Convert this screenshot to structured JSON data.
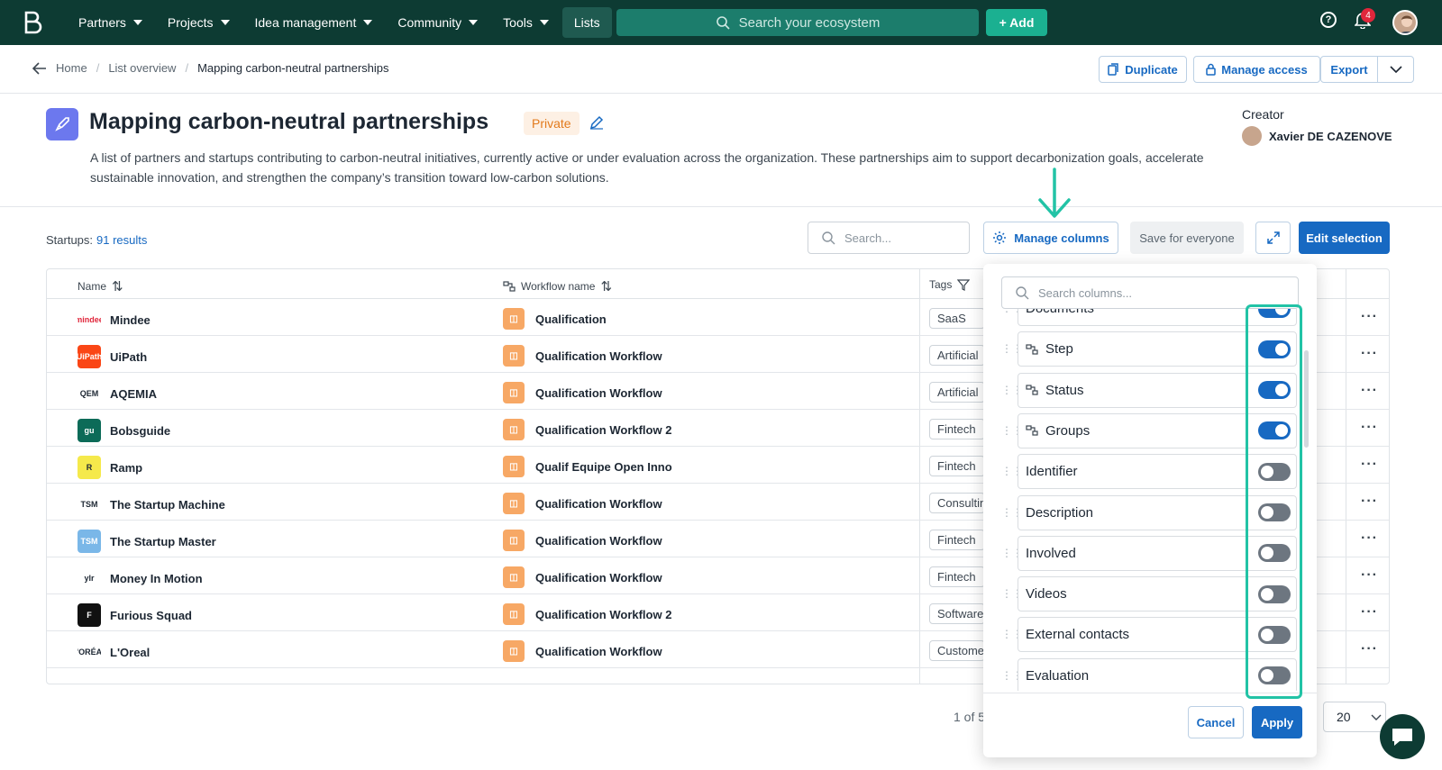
{
  "nav": {
    "items": [
      {
        "label": "Partners"
      },
      {
        "label": "Projects"
      },
      {
        "label": "Idea management"
      },
      {
        "label": "Community"
      },
      {
        "label": "Tools"
      },
      {
        "label": "Lists"
      }
    ],
    "search_placeholder": "Search your ecosystem",
    "add_label": "+ Add",
    "notifications_count": "4"
  },
  "breadcrumb": {
    "home": "Home",
    "list_overview": "List overview",
    "current": "Mapping carbon-neutral partnerships"
  },
  "header_actions": {
    "duplicate": "Duplicate",
    "manage_access": "Manage access",
    "export": "Export"
  },
  "list": {
    "title": "Mapping carbon-neutral partnerships",
    "visibility": "Private",
    "description": "A list of partners and startups contributing to carbon-neutral initiatives, currently active or under evaluation across the organization. These partnerships aim to support decarbonization goals, accelerate sustainable innovation, and strengthen the company’s transition toward low-carbon solutions.",
    "creator_label": "Creator",
    "creator_name": "Xavier DE CAZENOVE"
  },
  "toolbar": {
    "results_label": "Startups:",
    "results_count": "91 results",
    "search_placeholder": "Search...",
    "manage_columns": "Manage columns",
    "save_everyone": "Save for everyone",
    "edit_selection": "Edit selection"
  },
  "table": {
    "headers": {
      "name": "Name",
      "workflow": "Workflow name",
      "tags": "Tags"
    },
    "rows": [
      {
        "name": "Mindee",
        "logo": "mindee",
        "workflow": "Qualification",
        "tag": "SaaS"
      },
      {
        "name": "UiPath",
        "logo": "UiPath",
        "workflow": "Qualification Workflow",
        "tag": "Artificial"
      },
      {
        "name": "AQEMIA",
        "logo": "QEM",
        "workflow": "Qualification Workflow",
        "tag": "Artificial"
      },
      {
        "name": "Bobsguide",
        "logo": "gu",
        "workflow": "Qualification Workflow 2",
        "tag": "Fintech"
      },
      {
        "name": "Ramp",
        "logo": "R",
        "workflow": "Qualif Equipe Open Inno",
        "tag": "Fintech"
      },
      {
        "name": "The Startup Machine",
        "logo": "TSM",
        "workflow": "Qualification Workflow",
        "tag": "Consultin"
      },
      {
        "name": "The Startup Master",
        "logo": "TSM",
        "workflow": "Qualification Workflow",
        "tag": "Fintech"
      },
      {
        "name": "Money In Motion",
        "logo": "ylr",
        "workflow": "Qualification Workflow",
        "tag": "Fintech"
      },
      {
        "name": "Furious Squad",
        "logo": "F",
        "workflow": "Qualification Workflow 2",
        "tag": "Software"
      },
      {
        "name": "L'Oreal",
        "logo": "L'ORÉAL",
        "workflow": "Qualification Workflow",
        "tag": "Custome"
      }
    ]
  },
  "pagination": {
    "page_text": "1 of 5",
    "per_page": "20"
  },
  "columns_panel": {
    "search_placeholder": "Search columns...",
    "columns": [
      {
        "label": "Documents",
        "enabled": true,
        "has_icon": false
      },
      {
        "label": "Step",
        "enabled": true,
        "has_icon": true
      },
      {
        "label": "Status",
        "enabled": true,
        "has_icon": true
      },
      {
        "label": "Groups",
        "enabled": true,
        "has_icon": true
      },
      {
        "label": "Identifier",
        "enabled": false,
        "has_icon": false
      },
      {
        "label": "Description",
        "enabled": false,
        "has_icon": false
      },
      {
        "label": "Involved",
        "enabled": false,
        "has_icon": false
      },
      {
        "label": "Videos",
        "enabled": false,
        "has_icon": false
      },
      {
        "label": "External contacts",
        "enabled": false,
        "has_icon": false
      },
      {
        "label": "Evaluation",
        "enabled": false,
        "has_icon": false
      }
    ],
    "cancel": "Cancel",
    "apply": "Apply"
  },
  "colors": {
    "topbar": "#0d3b33",
    "accent": "#1769c2",
    "highlight": "#22c3a6",
    "workflow_icon": "#f7a865"
  }
}
